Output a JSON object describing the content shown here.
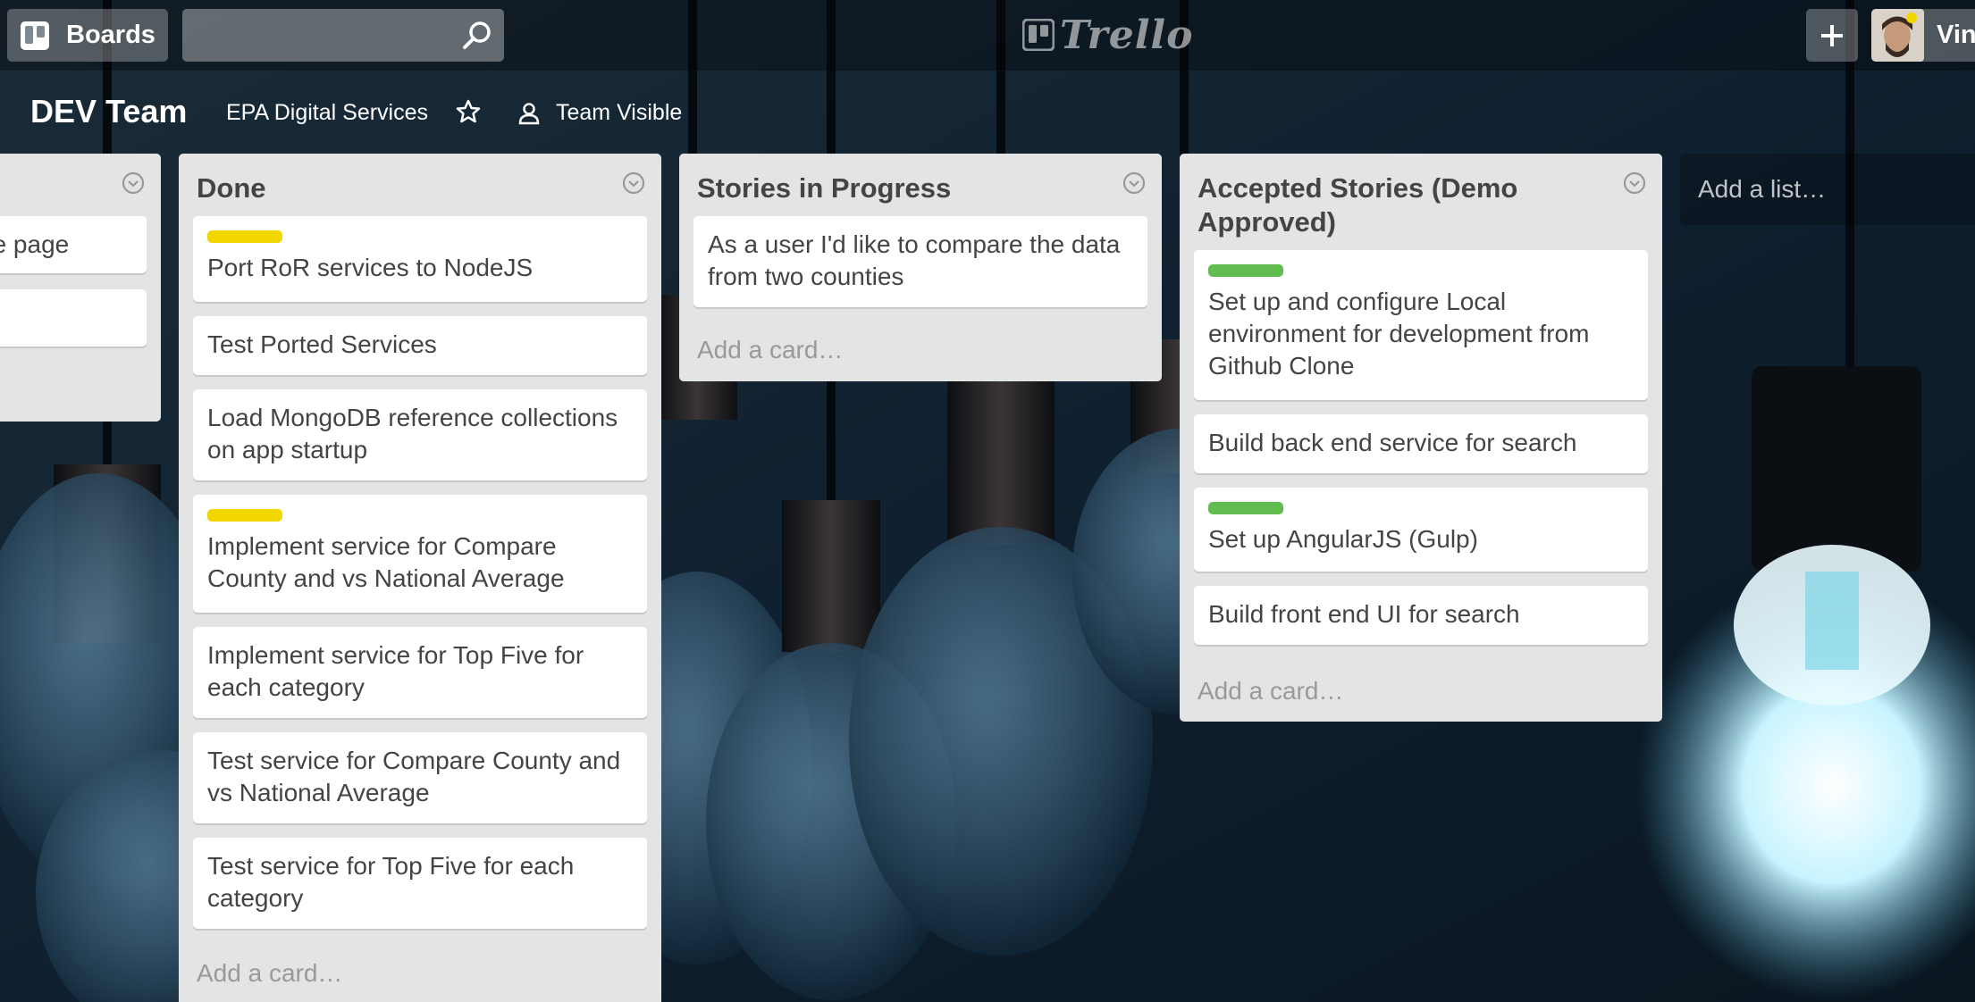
{
  "colors": {
    "label_yellow": "#f2d600",
    "label_green": "#61bd4f"
  },
  "header": {
    "boards_label": "Boards",
    "search_placeholder": "",
    "logo_text": "Trello",
    "member_name": "Vin"
  },
  "board": {
    "title": "DEV Team",
    "organization": "EPA Digital Services",
    "visibility": "Team Visible"
  },
  "lists": [
    {
      "title": "",
      "cards": [
        {
          "text": "ne page"
        },
        {
          "text": ""
        }
      ]
    },
    {
      "title": "Done",
      "cards": [
        {
          "label": "yellow",
          "text": "Port RoR services to NodeJS"
        },
        {
          "text": "Test Ported Services"
        },
        {
          "text": "Load MongoDB reference collections on app startup"
        },
        {
          "label": "yellow",
          "text": "Implement service for Compare County and vs National Average"
        },
        {
          "text": "Implement service for Top Five for each category"
        },
        {
          "text": "Test service for Compare County and vs National Average"
        },
        {
          "text": "Test service for Top Five for each category"
        }
      ],
      "add_card": "Add a card…"
    },
    {
      "title": "Stories in Progress",
      "cards": [
        {
          "text": "As a user I'd like to compare the data from two counties"
        }
      ],
      "add_card": "Add a card…"
    },
    {
      "title": "Accepted Stories (Demo Approved)",
      "cards": [
        {
          "label": "green",
          "text": "Set up and configure Local environment for development from Github Clone"
        },
        {
          "text": "Build back end service for search"
        },
        {
          "label": "green",
          "text": "Set up AngularJS (Gulp)"
        },
        {
          "text": "Build front end UI for search"
        }
      ],
      "add_card": "Add a card…"
    }
  ],
  "add_list": "Add a list…"
}
